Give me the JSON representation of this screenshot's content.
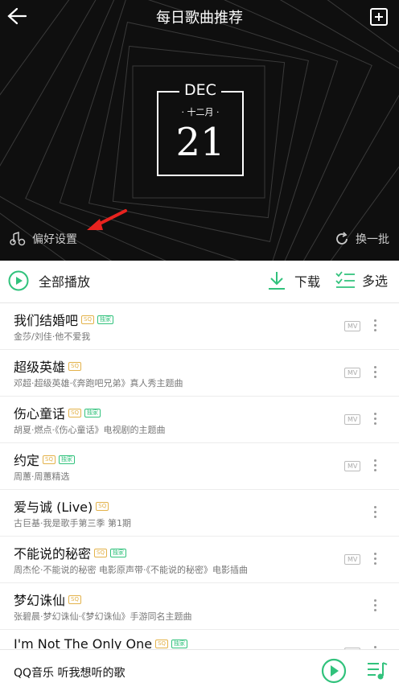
{
  "header": {
    "title": "每日歌曲推荐"
  },
  "date_card": {
    "month_en": "DEC",
    "month_cn": "· 十二月 ·",
    "day": "21"
  },
  "controls": {
    "preference_label": "偏好设置",
    "swap_label": "换一批"
  },
  "actions": {
    "play_all": "全部播放",
    "download": "下载",
    "multi_select": "多选"
  },
  "songs": [
    {
      "title": "我们结婚吧",
      "badges": [
        "SQ",
        "独家"
      ],
      "subtitle": "金莎/刘佳·他不爱我",
      "mv": "MV"
    },
    {
      "title": "超级英雄",
      "badges": [
        "SQ"
      ],
      "subtitle": "邓超·超级英雄·《奔跑吧兄弟》真人秀主题曲",
      "mv": "MV"
    },
    {
      "title": "伤心童话",
      "badges": [
        "SQ",
        "独家"
      ],
      "subtitle": "胡夏·燃点·《伤心童话》电视剧的主题曲",
      "mv": "MV"
    },
    {
      "title": "约定",
      "badges": [
        "SQ",
        "独家"
      ],
      "subtitle": "周蕙·周蕙精选",
      "mv": "MV"
    },
    {
      "title": "爱与诚 (Live)",
      "badges": [
        "SQ"
      ],
      "subtitle": "古巨基·我是歌手第三季 第1期",
      "mv": ""
    },
    {
      "title": "不能说的秘密",
      "badges": [
        "SQ",
        "独家"
      ],
      "subtitle": "周杰伦·不能说的秘密 电影原声带·《不能说的秘密》电影插曲",
      "mv": "MV"
    },
    {
      "title": "梦幻诛仙",
      "badges": [
        "SQ"
      ],
      "subtitle": "张碧晨·梦幻诛仙·《梦幻诛仙》手游同名主题曲",
      "mv": ""
    },
    {
      "title": "I'm Not The Only One",
      "badges": [
        "SQ",
        "独家"
      ],
      "subtitle": "",
      "mv": "MV"
    }
  ],
  "player": {
    "brand_text": "QQ音乐 听我想听的歌"
  },
  "colors": {
    "accent": "#31c27c",
    "hero_bg": "#0f0f0f",
    "arrow": "#e8231f"
  }
}
